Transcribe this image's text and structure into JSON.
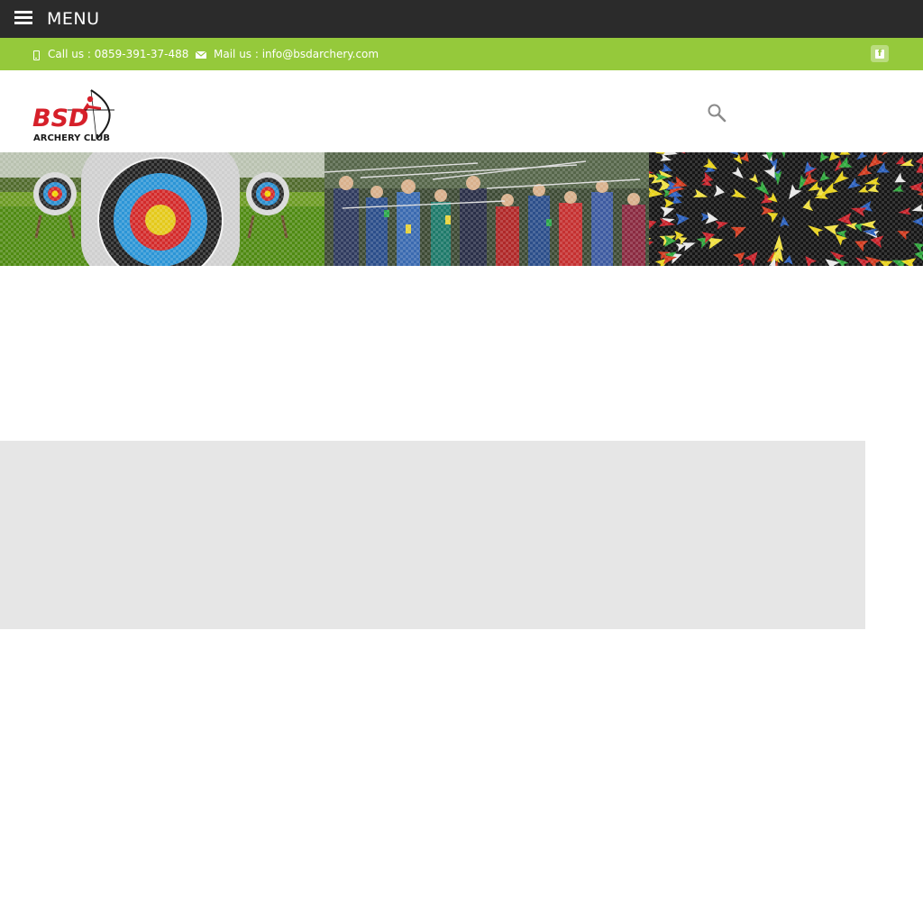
{
  "menubar": {
    "label": "MENU",
    "icon": "hamburger-menu-icon",
    "background": "#2b2b2b"
  },
  "contact": {
    "background": "#95c93b",
    "phone": {
      "icon": "mobile-phone-icon",
      "text": "Call us : 0859-391-37-488"
    },
    "mail": {
      "icon": "envelope-icon",
      "text": "Mail us : info@bsdarchery.com"
    },
    "social": {
      "icon": "facebook-icon",
      "letter": "f"
    }
  },
  "header": {
    "logo": {
      "name": "bsd-archery-club-logo",
      "brand": "BSD",
      "tagline": "ARCHERY CLUB",
      "brand_color": "#d6202a"
    },
    "search": {
      "icon": "search-icon"
    }
  },
  "banners": [
    {
      "name": "banner-archery-targets",
      "subject": "archery-targets"
    },
    {
      "name": "banner-archers-shooting-line",
      "subject": "archers-shooting"
    },
    {
      "name": "banner-arrow-fletchings",
      "subject": "arrow-fletchings"
    }
  ],
  "content": {
    "panel_color": "#e6e6e6"
  }
}
